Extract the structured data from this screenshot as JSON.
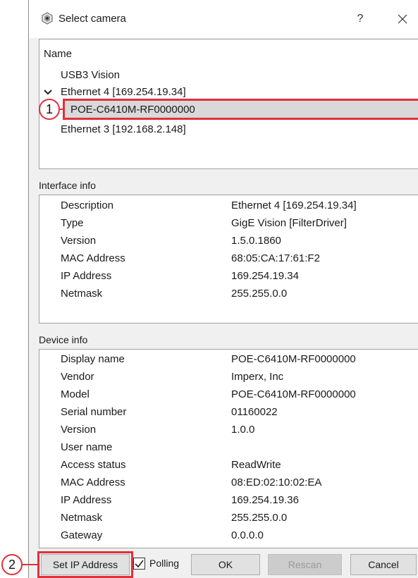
{
  "window": {
    "title": "Select camera",
    "help_label": "?",
    "close_label": "✕"
  },
  "tree": {
    "header": "Name",
    "items": [
      {
        "label": "USB3 Vision"
      },
      {
        "label": "Ethernet 4 [169.254.19.34]",
        "expanded": true
      },
      {
        "label": "POE-C6410M-RF0000000",
        "selected": true
      },
      {
        "label": "Ethernet 3 [192.168.2.148]"
      }
    ],
    "expander_icon": "chevron-down-icon"
  },
  "interface_info": {
    "title": "Interface info",
    "rows": [
      {
        "label": "Description",
        "value": "Ethernet 4 [169.254.19.34]"
      },
      {
        "label": "Type",
        "value": "GigE Vision [FilterDriver]"
      },
      {
        "label": "Version",
        "value": "1.5.0.1860"
      },
      {
        "label": "MAC Address",
        "value": "68:05:CA:17:61:F2"
      },
      {
        "label": "IP Address",
        "value": "169.254.19.34"
      },
      {
        "label": "Netmask",
        "value": "255.255.0.0"
      }
    ]
  },
  "device_info": {
    "title": "Device info",
    "rows": [
      {
        "label": "Display name",
        "value": "POE-C6410M-RF0000000"
      },
      {
        "label": "Vendor",
        "value": "Imperx, Inc"
      },
      {
        "label": "Model",
        "value": "POE-C6410M-RF0000000"
      },
      {
        "label": "Serial number",
        "value": "01160022"
      },
      {
        "label": "Version",
        "value": "1.0.0"
      },
      {
        "label": "User name",
        "value": ""
      },
      {
        "label": "Access status",
        "value": "ReadWrite"
      },
      {
        "label": "MAC Address",
        "value": "08:ED:02:10:02:EA"
      },
      {
        "label": "IP Address",
        "value": "169.254.19.36"
      },
      {
        "label": "Netmask",
        "value": "255.255.0.0"
      },
      {
        "label": "Gateway",
        "value": "0.0.0.0"
      }
    ]
  },
  "buttons": {
    "set_ip": "Set IP Address",
    "polling": "Polling",
    "polling_checked": true,
    "ok": "OK",
    "rescan": "Rescan",
    "cancel": "Cancel"
  },
  "callouts": {
    "one": "1",
    "two": "2"
  },
  "colors": {
    "highlight": "#e0303c",
    "selection": "#d9d9d9"
  }
}
